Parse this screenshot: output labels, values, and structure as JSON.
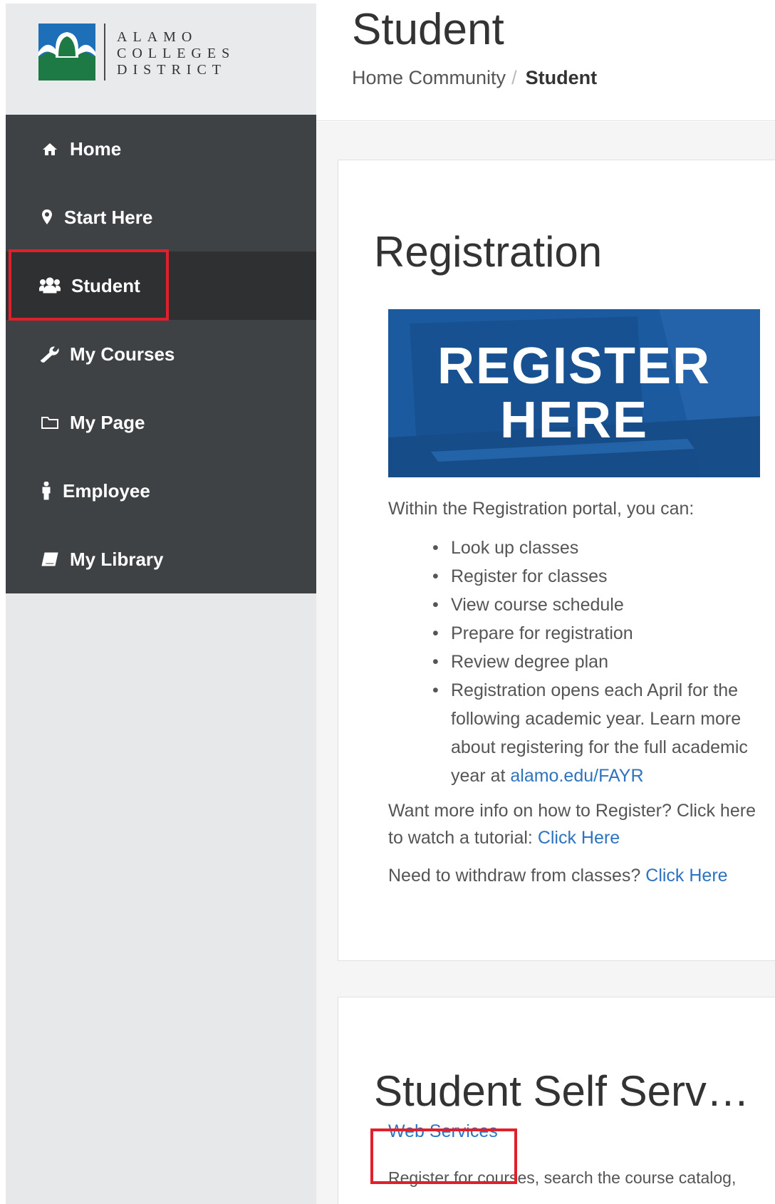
{
  "logo": {
    "line1": "ALAMO",
    "line2": "COLLEGES",
    "line3": "DISTRICT"
  },
  "nav": {
    "items": [
      {
        "label": "Home",
        "icon": "home-icon"
      },
      {
        "label": "Start Here",
        "icon": "map-marker-icon"
      },
      {
        "label": "Student",
        "icon": "users-icon",
        "active": true
      },
      {
        "label": "My Courses",
        "icon": "wrench-icon"
      },
      {
        "label": "My Page",
        "icon": "folder-icon"
      },
      {
        "label": "Employee",
        "icon": "person-icon"
      },
      {
        "label": "My Library",
        "icon": "book-icon"
      }
    ]
  },
  "header": {
    "title": "Student",
    "breadcrumb": {
      "parent": "Home Community",
      "separator": "/",
      "current": "Student"
    }
  },
  "registration": {
    "title": "Registration",
    "banner_line1": "REGISTER",
    "banner_line2": "HERE",
    "intro": "Within the Registration portal, you can:",
    "bullets": [
      "Look up classes",
      "Register for classes",
      "View course schedule",
      "Prepare for registration",
      "Review degree plan"
    ],
    "last_bullet_text": "Registration opens each April for the following academic year.  Learn more about registering for the full academic year at ",
    "last_bullet_link": "alamo.edu/FAYR",
    "tutorial_text": "Want more info on how to Register? Click here to watch a tutorial: ",
    "tutorial_link": "Click Here",
    "withdraw_text": "Need to withdraw from classes? ",
    "withdraw_link": "Click Here"
  },
  "self_service": {
    "title": "Student Self Serv…",
    "web_services_link": "Web Services",
    "description": "Register for courses, search the course catalog,"
  },
  "colors": {
    "sidebar_dark": "#3f4244",
    "sidebar_active": "#2e3032",
    "banner_blue": "#1c5aa0",
    "link_blue": "#2d73c0",
    "highlight_red": "#e0202a",
    "logo_blue": "#1d6fb8",
    "logo_green": "#1e7a45"
  }
}
